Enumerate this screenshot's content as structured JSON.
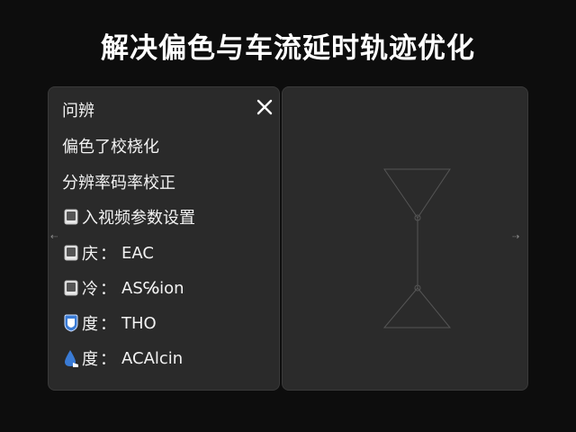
{
  "page": {
    "title": "解决偏色与车流延时轨迹优化"
  },
  "menu": {
    "header": "问辨",
    "items": [
      {
        "label": "偏色了校桡化",
        "value": "",
        "icon": ""
      },
      {
        "label": "分辨率码率校正",
        "value": "",
        "icon": ""
      },
      {
        "label": "入视频参数设置",
        "value": "",
        "icon": "device-icon"
      },
      {
        "label": "庆",
        "sep": "：",
        "value": "EAC",
        "icon": "device-icon"
      },
      {
        "label": "冷",
        "sep": "：",
        "value": "AS℅ion",
        "icon": "device-icon"
      },
      {
        "label": "度",
        "sep": "：",
        "value": "THO",
        "icon": "shield-icon"
      },
      {
        "label": "度",
        "sep": "：",
        "value": "ACAlcin",
        "icon": "droplet-icon"
      }
    ]
  },
  "colors": {
    "accent": "#3a7bd5",
    "text": "#f2f2f2",
    "panel": "#2a2a2a"
  }
}
